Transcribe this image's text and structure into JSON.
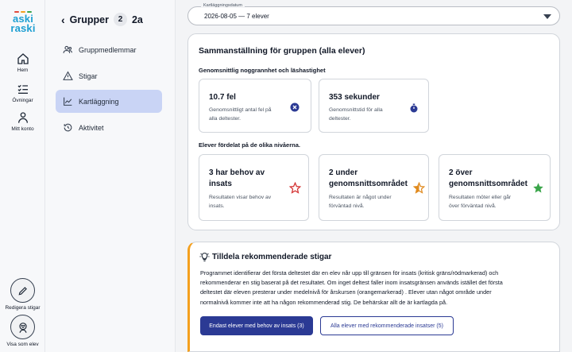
{
  "logo": {
    "line1": "aski",
    "line2": "raski",
    "colors": [
      "#e2483a",
      "#f4a01e",
      "#3aa54a",
      "#1e9fd2"
    ]
  },
  "rail": {
    "home": "Hem",
    "exercises": "Övningar",
    "account": "Mitt konto",
    "edit_paths": "Redigera stigar",
    "view_as_student": "Visa som elev"
  },
  "nav": {
    "title": "Grupper",
    "count": "2",
    "group": "2a",
    "items": [
      {
        "label": "Gruppmedlemmar",
        "icon": "users-icon"
      },
      {
        "label": "Stigar",
        "icon": "warning-icon"
      },
      {
        "label": "Kartläggning",
        "icon": "chart-icon",
        "active": true
      },
      {
        "label": "Aktivitet",
        "icon": "history-icon"
      }
    ]
  },
  "date_select": {
    "legend": "Kartläggningsdatum",
    "value": "2026-08-05 — 7 elever"
  },
  "summary": {
    "title": "Sammanställning för gruppen (alla elever)",
    "accuracy_heading": "Genomsnittlig noggrannhet och läshastighet",
    "errors": {
      "value": "10.7 fel",
      "desc_l1": "Genomsnittligt antal fel på",
      "desc_l2": "alla deltester."
    },
    "time": {
      "value": "353 sekunder",
      "desc_l1": "Genomsnittstid för alla",
      "desc_l2": "deltester."
    },
    "levels_heading": "Elever fördelat på de olika nivåerna.",
    "needs": {
      "l1": "3 har behov av",
      "l2": "insats",
      "desc_l1": "Resultaten visar behov av",
      "desc_l2": "insats."
    },
    "below": {
      "l1": "2 under",
      "l2": "genomsnittsområdet",
      "desc_l1": "Resultaten är något under",
      "desc_l2": "förväntad nivå."
    },
    "above": {
      "l1": "2 över",
      "l2": "genomsnittsområdet",
      "desc_l1": "Resultaten möter eller går",
      "desc_l2": "över förväntad nivå."
    }
  },
  "recommend": {
    "title": "Tilldela rekommenderade stigar",
    "body_l1": "Programmet identifierar det första deltestet där en elev når upp till gränsen för insats (kritisk gräns/rödmarkerad) och",
    "body_l2": "rekommenderar en stig baserat på det resultatet. Om inget deltest faller inom insatsgränsen används istället det första",
    "body_l3": "deltestet där eleven presterar under medelnivå för årskursen (orangemarkerad) . Elever utan något område under",
    "body_l4": "normalnivå kommer inte att ha någon rekommenderad stig. De behärskar allt de är kartlagda på.",
    "btn_primary": "Endast elever med behov av insats (3)",
    "btn_secondary": "Alla elever med rekommenderade insatser (5)"
  },
  "colors": {
    "accent": "#2b3a94",
    "active_nav": "#c9d4f5",
    "warning_border": "#f4a01e",
    "star_red": "#d32f2f",
    "star_orange": "#e08a1e",
    "star_green": "#3aa54a"
  }
}
